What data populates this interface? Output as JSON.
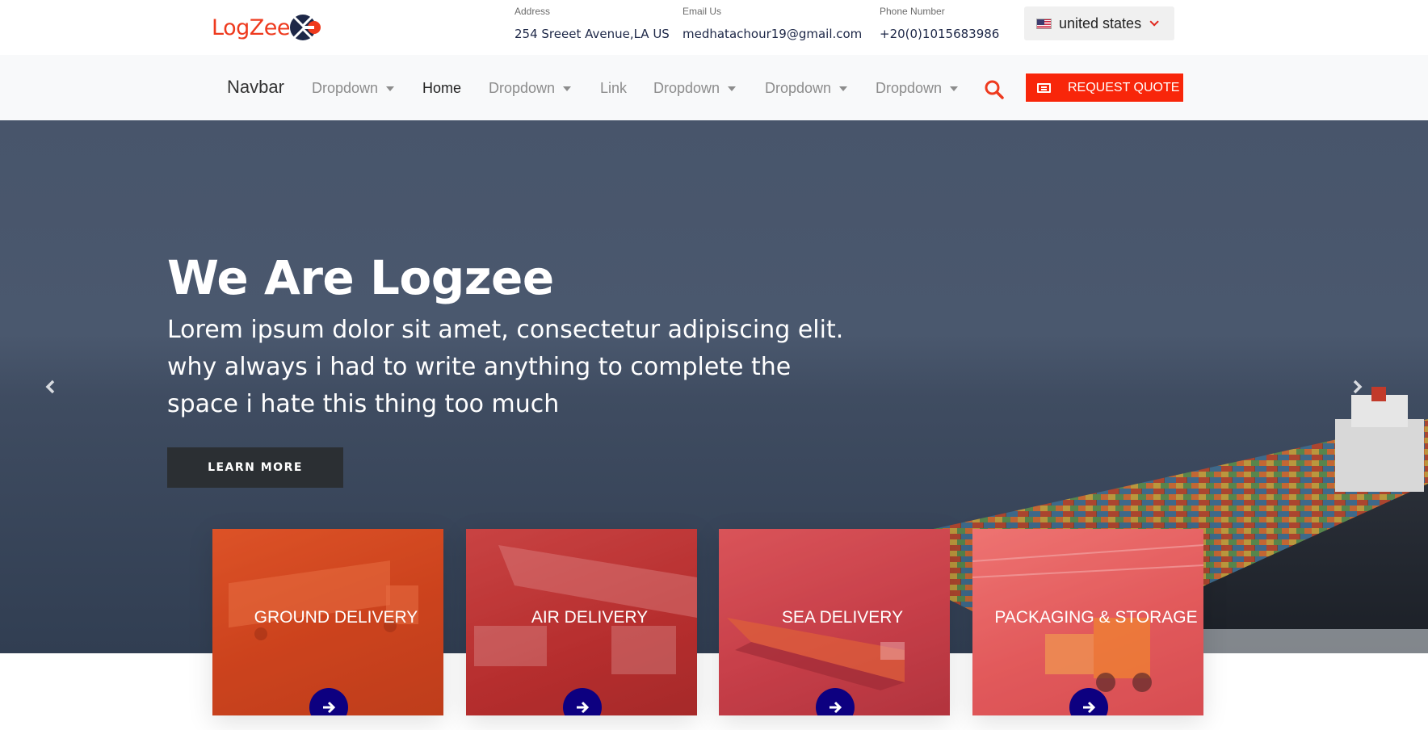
{
  "brand": {
    "logo_text": "LogZee",
    "accent": "#ee3a1e"
  },
  "contact": {
    "address_label": "Address",
    "address_value": "254 Sreeet Avenue,LA US",
    "email_label": "Email Us",
    "email_value": "medhatachour19@gmail.com",
    "phone_label": "Phone Number",
    "phone_value": "+20(0)1015683986"
  },
  "country_select": {
    "selected": "united states",
    "flag": "us-flag-icon"
  },
  "navbar": {
    "brand": "Navbar",
    "items": [
      {
        "label": "Dropdown",
        "dropdown": true
      },
      {
        "label": "Home",
        "dropdown": false,
        "active": true
      },
      {
        "label": "Dropdown",
        "dropdown": true
      },
      {
        "label": "Link",
        "dropdown": false
      },
      {
        "label": "Dropdown",
        "dropdown": true
      },
      {
        "label": "Dropdown",
        "dropdown": true
      },
      {
        "label": "Dropdown",
        "dropdown": true
      }
    ],
    "search_icon": "search-icon",
    "quote_label": "REQUEST QUOTE",
    "quote_color": "#f8260a"
  },
  "hero": {
    "title": "We Are Logzee",
    "text": "Lorem ipsum dolor sit amet, consectetur adipiscing elit. why always i had to write anything to complete the space i hate this thing too much",
    "button": "LEARN MORE"
  },
  "services": [
    {
      "title": "GROUND DELIVERY",
      "icon": "arrow-right-icon"
    },
    {
      "title": "AIR DELIVERY",
      "icon": "arrow-right-icon"
    },
    {
      "title": "SEA DELIVERY",
      "icon": "arrow-right-icon"
    },
    {
      "title": "PACKAGING & STORAGE",
      "icon": "arrow-right-icon"
    }
  ]
}
